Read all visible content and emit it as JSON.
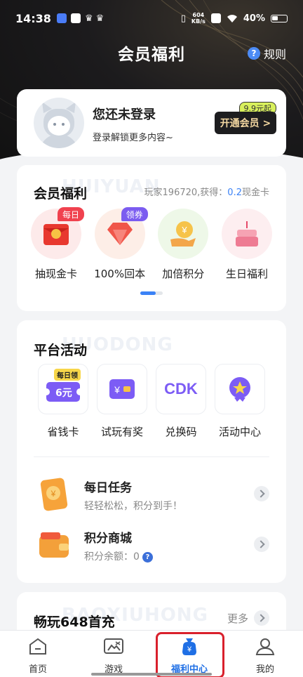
{
  "status_bar": {
    "time": "14:38",
    "net_speed_value": "604",
    "net_speed_unit": "KB/s",
    "battery": "40%"
  },
  "header": {
    "title": "会员福利",
    "rules_label": "规则",
    "rules_icon": "?"
  },
  "login_card": {
    "name": "您还未登录",
    "subtitle": "登录解锁更多内容~",
    "vip_button": "开通会员 >",
    "vip_tag": "9.9元起"
  },
  "benefits": {
    "title": "会员福利",
    "watermark": "HUIYUAN",
    "note_prefix": "玩家196720,获得：",
    "note_value": "0.2",
    "note_suffix": "现金卡",
    "items": [
      {
        "label": "抽现金卡",
        "badge": "每日",
        "badge_color": "#f0424f",
        "icon": "red-envelope-icon"
      },
      {
        "label": "100%回本",
        "badge": "领券",
        "badge_color": "#7b5cf0",
        "icon": "diamond-icon"
      },
      {
        "label": "加倍积分",
        "badge": "",
        "icon": "coin-hand-icon"
      },
      {
        "label": "生日福利",
        "badge": "",
        "icon": "birthday-cake-icon"
      }
    ]
  },
  "platform": {
    "title": "平台活动",
    "watermark": "HUODONG",
    "items": [
      {
        "label": "省钱卡",
        "icon": "money-saving-card-icon",
        "tag": "每日领",
        "card_text": "6元"
      },
      {
        "label": "试玩有奖",
        "icon": "trial-reward-icon"
      },
      {
        "label": "兑换码",
        "icon": "cdk-icon",
        "icon_text": "CDK"
      },
      {
        "label": "活动中心",
        "icon": "activity-center-icon"
      }
    ],
    "tasks": [
      {
        "name": "每日任务",
        "sub": "轻轻松松，积分到手！",
        "icon": "daily-task-icon"
      },
      {
        "name": "积分商城",
        "sub": "积分余额：",
        "value": "0",
        "icon": "wallet-icon",
        "help": "?"
      }
    ]
  },
  "recharge": {
    "title": "畅玩648首充",
    "watermark": "BAOXIUHONG",
    "more_label": "更多"
  },
  "tabbar": {
    "tabs": [
      {
        "label": "首页",
        "icon": "home-icon"
      },
      {
        "label": "游戏",
        "icon": "game-icon"
      },
      {
        "label": "福利中心",
        "icon": "welfare-bag-icon",
        "active": true
      },
      {
        "label": "我的",
        "icon": "profile-icon"
      }
    ]
  },
  "colors": {
    "accent": "#3b82f6",
    "active_tab": "#1f6fe5",
    "highlight_border": "#d9202c"
  }
}
